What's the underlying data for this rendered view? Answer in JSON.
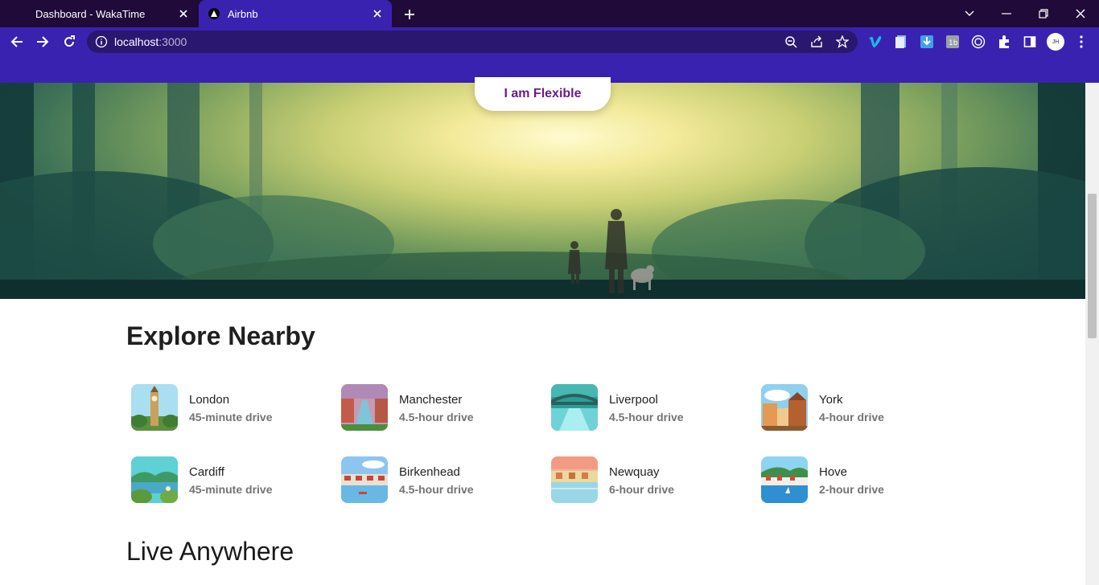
{
  "browser": {
    "tabs": [
      {
        "title": "Dashboard - WakaTime",
        "active": false
      },
      {
        "title": "Airbnb",
        "active": true
      }
    ],
    "url_host": "localhost",
    "url_port": ":3000",
    "accent": "#3a22b0",
    "tabstrip_color": "#1f0a3a",
    "profile_initials": "JH"
  },
  "hero": {
    "button_label": "I am Flexible",
    "button_color": "#6b1b8f"
  },
  "explore": {
    "title": "Explore Nearby",
    "items": [
      {
        "name": "London",
        "distance": "45-minute drive",
        "thumb": "big-ben"
      },
      {
        "name": "Manchester",
        "distance": "4.5-hour drive",
        "thumb": "canal-dusk"
      },
      {
        "name": "Liverpool",
        "distance": "4.5-hour drive",
        "thumb": "bridge-river"
      },
      {
        "name": "York",
        "distance": "4-hour drive",
        "thumb": "old-town"
      },
      {
        "name": "Cardiff",
        "distance": "45-minute drive",
        "thumb": "lake-hills"
      },
      {
        "name": "Birkenhead",
        "distance": "4.5-hour drive",
        "thumb": "harbour"
      },
      {
        "name": "Newquay",
        "distance": "6-hour drive",
        "thumb": "sunset-coast"
      },
      {
        "name": "Hove",
        "distance": "2-hour drive",
        "thumb": "seaside-village"
      }
    ]
  },
  "live": {
    "title": "Live Anywhere"
  }
}
